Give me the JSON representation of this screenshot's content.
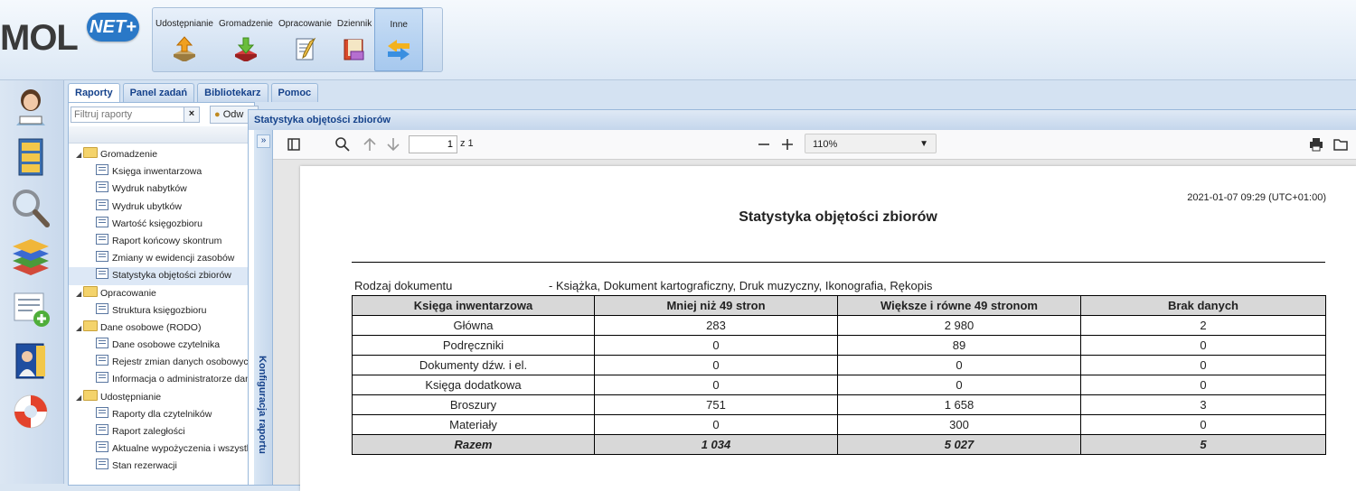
{
  "app": {
    "logo_text": "MOL",
    "logo_badge": "NET+"
  },
  "topnav": [
    {
      "label": "Udostępnianie",
      "icon": "upload-arrow-icon"
    },
    {
      "label": "Gromadzenie",
      "icon": "download-arrow-icon"
    },
    {
      "label": "Opracowanie",
      "icon": "edit-document-icon"
    },
    {
      "label": "Dziennik",
      "icon": "journal-icon"
    },
    {
      "label": "Inne",
      "icon": "exchange-arrows-icon"
    }
  ],
  "left_icons": [
    "librarian-icon",
    "catalog-cabinet-icon",
    "search-magnifier-icon",
    "books-stack-icon",
    "add-record-icon",
    "reader-book-icon",
    "lifebuoy-icon"
  ],
  "tabs": [
    "Raporty",
    "Panel zadań",
    "Bibliotekarz",
    "Pomoc"
  ],
  "filter": {
    "placeholder": "Filtruj raporty",
    "clear": "×",
    "button_label": "Odw"
  },
  "tree": [
    {
      "type": "folder",
      "label": "Gromadzenie"
    },
    {
      "type": "leaf",
      "label": "Księga inwentarzowa"
    },
    {
      "type": "leaf",
      "label": "Wydruk nabytków"
    },
    {
      "type": "leaf",
      "label": "Wydruk ubytków"
    },
    {
      "type": "leaf",
      "label": "Wartość księgozbioru"
    },
    {
      "type": "leaf",
      "label": "Raport końcowy skontrum"
    },
    {
      "type": "leaf",
      "label": "Zmiany w ewidencji zasobów"
    },
    {
      "type": "leaf",
      "label": "Statystyka objętości zbiorów",
      "selected": true
    },
    {
      "type": "folder",
      "label": "Opracowanie"
    },
    {
      "type": "leaf",
      "label": "Struktura księgozbioru"
    },
    {
      "type": "folder",
      "label": "Dane osobowe (RODO)"
    },
    {
      "type": "leaf",
      "label": "Dane osobowe czytelnika"
    },
    {
      "type": "leaf",
      "label": "Rejestr zmian danych osobowych"
    },
    {
      "type": "leaf",
      "label": "Informacja o administratorze danych"
    },
    {
      "type": "folder",
      "label": "Udostępnianie"
    },
    {
      "type": "leaf",
      "label": "Raporty dla czytelników"
    },
    {
      "type": "leaf",
      "label": "Raport zaległości"
    },
    {
      "type": "leaf",
      "label": "Aktualne wypożyczenia i wszystkie"
    },
    {
      "type": "leaf",
      "label": "Stan rezerwacji"
    }
  ],
  "panel": {
    "title": "Statystyka objętości zbiorów",
    "collapse": "»",
    "config_label": "Konfiguracja raportu"
  },
  "pdf": {
    "page_current": "1",
    "page_of": "z 1",
    "zoom": "110%"
  },
  "report": {
    "date": "2021-01-07 09:29 (UTC+01:00)",
    "title": "Statystyka objętości zbiorów",
    "rodzaj_label": "Rodzaj dokumentu",
    "rodzaj_value": "- Książka, Dokument kartograficzny, Druk muzyczny, Ikonografia, Rękopis",
    "columns": [
      "Księga inwentarzowa",
      "Mniej niż 49 stron",
      "Większe i równe 49 stronom",
      "Brak danych"
    ],
    "rows": [
      [
        "Główna",
        "283",
        "2 980",
        "2"
      ],
      [
        "Podręczniki",
        "0",
        "89",
        "0"
      ],
      [
        "Dokumenty dźw. i el.",
        "0",
        "0",
        "0"
      ],
      [
        "Księga dodatkowa",
        "0",
        "0",
        "0"
      ],
      [
        "Broszury",
        "751",
        "1 658",
        "3"
      ],
      [
        "Materiały",
        "0",
        "300",
        "0"
      ]
    ],
    "total": [
      "Razem",
      "1 034",
      "5 027",
      "5"
    ]
  }
}
